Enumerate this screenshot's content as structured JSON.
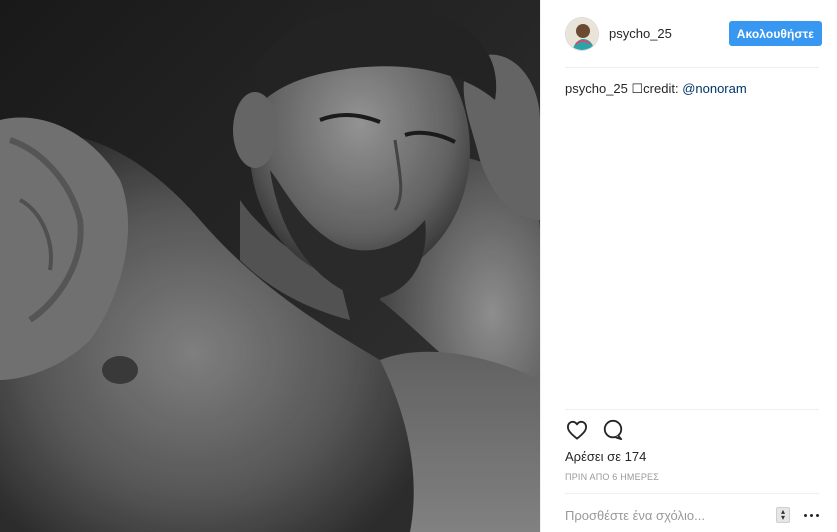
{
  "post": {
    "photo_alt": "",
    "author": {
      "username": "psycho_25",
      "follow_label": "Ακολουθήστε"
    },
    "caption": {
      "username": "psycho_25",
      "separator": " ☐",
      "text": "credit: ",
      "mention": "@nonoram"
    },
    "actions": {
      "like_icon": "heart-icon",
      "comment_icon": "comment-icon"
    },
    "likes_text": "Αρέσει σε 174",
    "timestamp": "ΠΡΙΝ ΑΠΟ 6 ΗΜΕΡΕΣ",
    "comment_box": {
      "placeholder": "Προσθέστε ένα σχόλιο...",
      "more_icon": "more-horizontal-icon"
    }
  },
  "colors": {
    "accent": "#3897f0",
    "mention": "#003569",
    "text": "#262626",
    "muted": "#999999",
    "divider": "#efefef"
  }
}
